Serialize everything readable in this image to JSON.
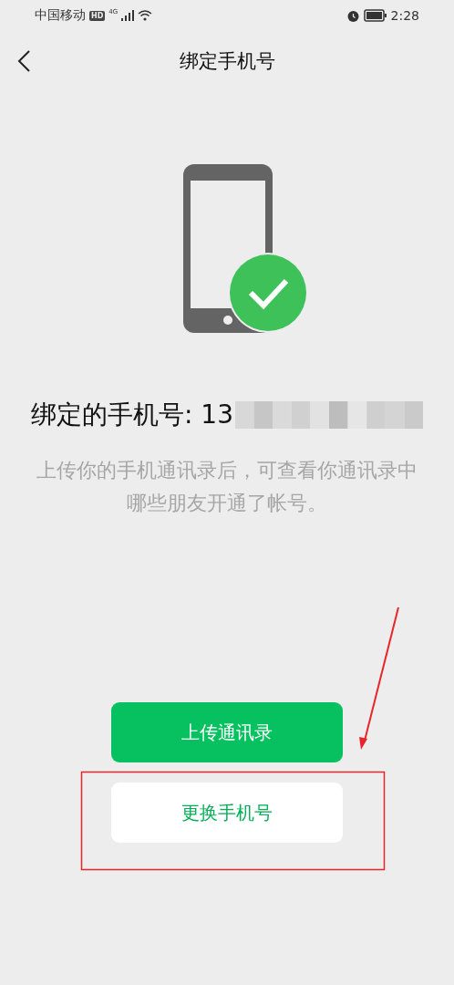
{
  "status_bar": {
    "carrier": "中国移动",
    "hd_badge": "HD",
    "network": "4G",
    "time": "2:28"
  },
  "nav": {
    "title": "绑定手机号"
  },
  "bound_number": {
    "label": "绑定的手机号: 13"
  },
  "description": "上传你的手机通讯录后，可查看你通讯录中哪些朋友开通了帐号。",
  "buttons": [
    {
      "label": "上传通讯录",
      "kind": "primary"
    },
    {
      "label": "更换手机号",
      "kind": "secondary"
    }
  ],
  "annotation": {
    "arrow": true,
    "highlight_box": true
  }
}
